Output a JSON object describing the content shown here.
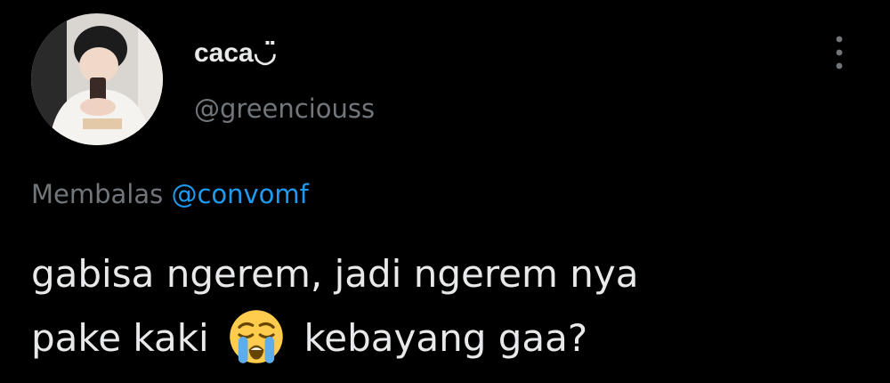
{
  "user": {
    "display_name": "caca",
    "name_decoration": "◡̈",
    "handle": "@greenciouss"
  },
  "reply": {
    "prefix": "Membalas",
    "mention": "@convomf"
  },
  "tweet": {
    "line1": "gabisa ngerem, jadi ngerem nya",
    "line2_before": "pake kaki",
    "emoji": "loudly-crying-face",
    "line2_after": "kebayang gaa?"
  },
  "icons": {
    "more": "more-vertical-icon"
  },
  "colors": {
    "background": "#000000",
    "primary_text": "#e7e9ea",
    "secondary_text": "#71767b",
    "accent": "#1d9bf0"
  }
}
